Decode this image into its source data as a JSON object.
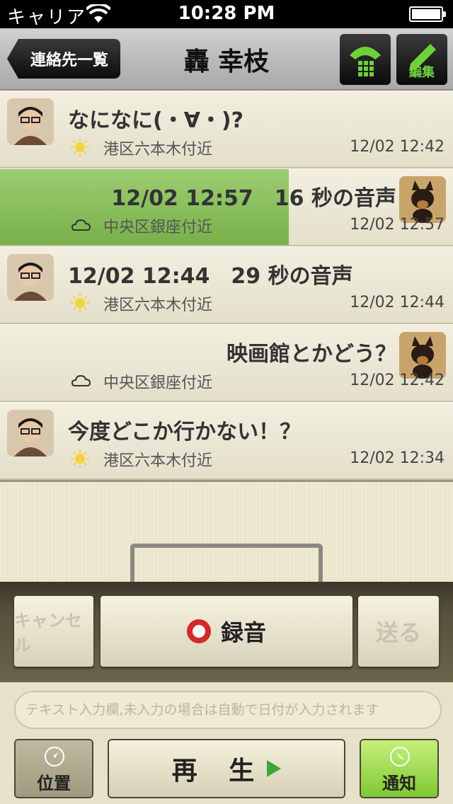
{
  "status": {
    "carrier": "キャリア",
    "time": "10:28 PM"
  },
  "nav": {
    "back_label": "連絡先一覧",
    "title": "轟 幸枝",
    "edit_label": "編集"
  },
  "messages": [
    {
      "side": "left",
      "avatar": "man-avatar",
      "text": "なになに(・∀・)?",
      "weather": "sun-icon",
      "location": "港区六本木付近",
      "time": "12/02 12:42",
      "highlight": false
    },
    {
      "side": "right",
      "avatar": "dog-avatar",
      "text": "12/02 12:57　16 秒の音声",
      "weather": "cloud-icon",
      "location": "中央区銀座付近",
      "time": "12/02 12:57",
      "highlight": true
    },
    {
      "side": "left",
      "avatar": "man-avatar",
      "text": "12/02 12:44　29 秒の音声",
      "weather": "sun-icon",
      "location": "港区六本木付近",
      "time": "12/02 12:44",
      "highlight": false
    },
    {
      "side": "right",
      "avatar": "dog-avatar",
      "text": "映画館とかどう？",
      "weather": "cloud-icon",
      "location": "中央区銀座付近",
      "time": "12/02 12:42",
      "highlight": false
    },
    {
      "side": "left",
      "avatar": "man-avatar",
      "text": "今度どこか行かない！？",
      "weather": "sun-icon",
      "location": "港区六本木付近",
      "time": "12/02 12:34",
      "highlight": false
    }
  ],
  "controls": {
    "cancel_label": "キャンセル",
    "record_label": "録音",
    "send_label": "送る"
  },
  "input": {
    "placeholder": "テキスト入力欄,未入力の場合は自動で日付が入力されます"
  },
  "bottom": {
    "location_label": "位置",
    "play_label": "再 生",
    "notify_label": "通知"
  },
  "colors": {
    "highlight_green": "#8cc25e",
    "record_red": "#d02a2a",
    "notify_green": "#9fdc52"
  }
}
